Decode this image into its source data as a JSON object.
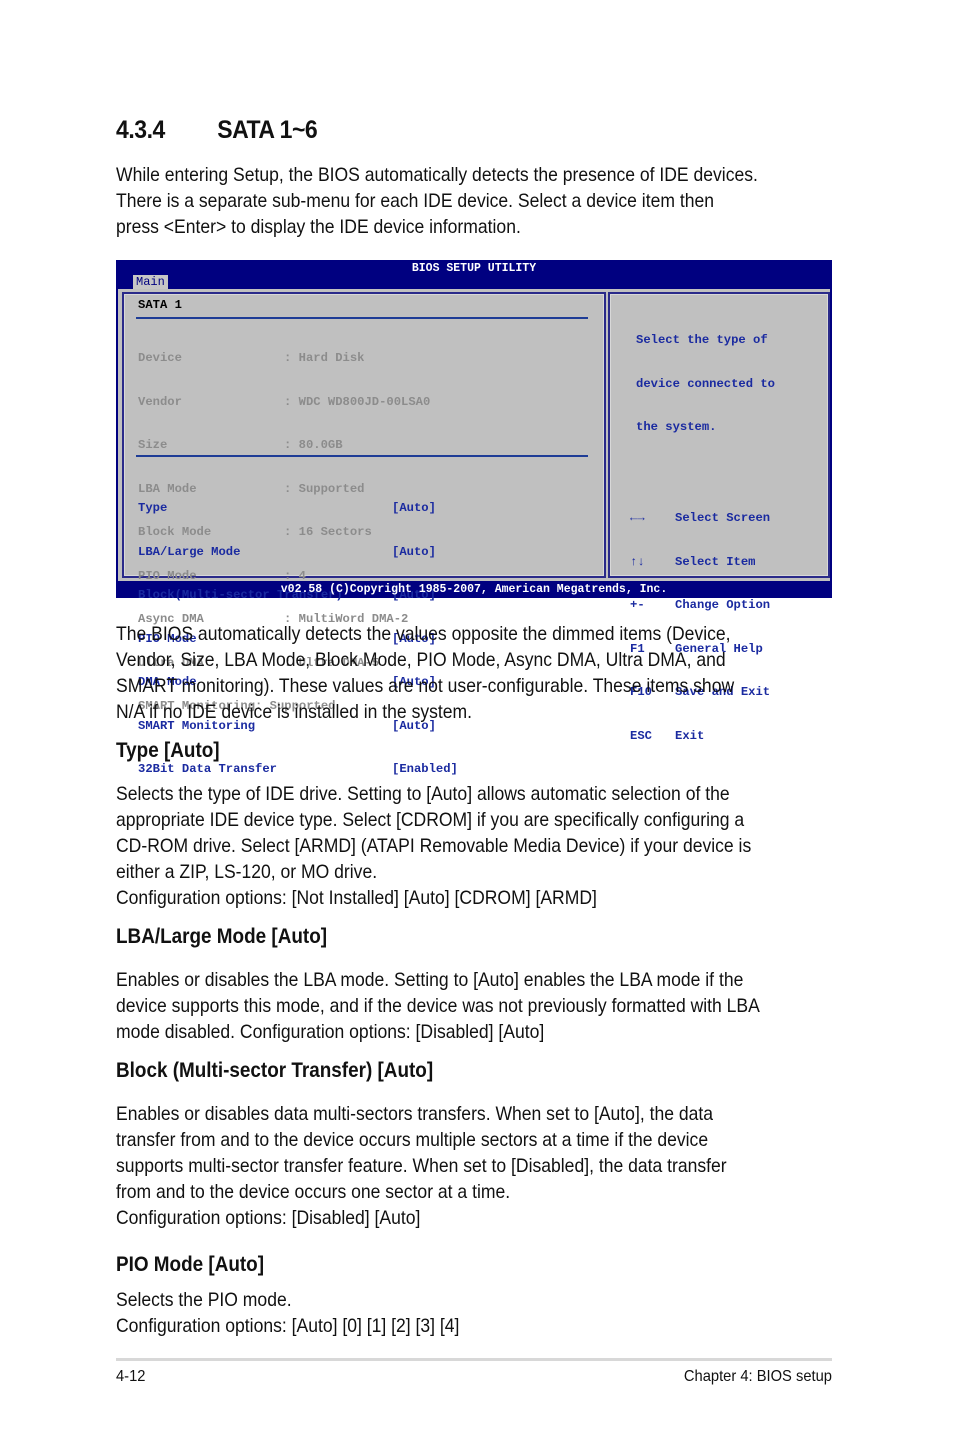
{
  "section": {
    "number": "4.3.4",
    "title": "SATA 1~6",
    "intro": [
      "While entering Setup, the BIOS automatically detects the presence of IDE devices.",
      "There is a separate sub-menu for each IDE device. Select a device item then",
      "press <Enter> to display the IDE device information."
    ]
  },
  "bios": {
    "title": "BIOS SETUP UTILITY",
    "tab": "Main",
    "panel_title": "SATA 1",
    "info": [
      {
        "label": "Device",
        "value": ": Hard Disk"
      },
      {
        "label": "Vendor",
        "value": ": WDC WD800JD-00LSA0"
      },
      {
        "label": "Size",
        "value": ": 80.0GB"
      },
      {
        "label": "LBA Mode",
        "value": ": Supported"
      },
      {
        "label": "Block Mode",
        "value": ": 16 Sectors"
      },
      {
        "label": "PIO Mode",
        "value": ": 4"
      },
      {
        "label": "Async DMA",
        "value": ": MultiWord DMA-2"
      },
      {
        "label": "Ultra DMA",
        "value": ": Ultra DMA-5"
      },
      {
        "label": "SMART Monitoring",
        "value": ": Supported"
      }
    ],
    "options": [
      {
        "label": "Type",
        "value": "[Auto]"
      },
      {
        "label": "LBA/Large Mode",
        "value": "[Auto]"
      },
      {
        "label": "Block(Multi-sector Transfer)",
        "value": "[Auto]"
      },
      {
        "label": "PIO Mode",
        "value": "[Auto]"
      },
      {
        "label": "DMA Mode",
        "value": "[Auto]"
      },
      {
        "label": "SMART Monitoring",
        "value": "[Auto]"
      },
      {
        "label": "32Bit Data Transfer",
        "value": "[Enabled]"
      }
    ],
    "help": [
      "Select the type of",
      "device connected to",
      "the system."
    ],
    "keys": [
      {
        "key": "←→",
        "icon": "left-right-arrows-icon",
        "action": "Select Screen"
      },
      {
        "key": "↑↓",
        "icon": "up-down-arrows-icon",
        "action": "Select Item"
      },
      {
        "key": "+-",
        "action": "Change Option"
      },
      {
        "key": "F1",
        "action": "General Help"
      },
      {
        "key": "F10",
        "action": "Save and Exit"
      },
      {
        "key": "ESC",
        "action": "Exit"
      }
    ],
    "footer": "v02.58 (C)Copyright 1985-2007, American Megatrends, Inc.",
    "colors": {
      "frame": "#000080",
      "panel": "#c0c0c0",
      "option_text": "#1a2aa0",
      "dim_text": "#8c8c8c"
    }
  },
  "after_bios": [
    "The BIOS automatically detects the values opposite the dimmed items (Device,",
    "Vendor, Size, LBA Mode, Block Mode, PIO Mode, Async DMA, Ultra DMA, and",
    "SMART monitoring). These values are not user-configurable. These items show",
    "N/A if no IDE device is installed in the system."
  ],
  "items": [
    {
      "heading": "Type [Auto]",
      "lines": [
        "Selects the type of IDE drive. Setting to [Auto] allows automatic selection of the",
        "appropriate IDE device type. Select [CDROM] if you are specifically configuring a",
        "CD-ROM drive. Select [ARMD] (ATAPI Removable Media Device) if your device is",
        "either a ZIP, LS-120, or MO drive.",
        "Configuration options: [Not Installed] [Auto] [CDROM] [ARMD]"
      ]
    },
    {
      "heading": "LBA/Large Mode [Auto]",
      "lines": [
        "Enables or disables the LBA mode. Setting to [Auto] enables the LBA mode if the",
        "device supports this mode, and if the device was not previously formatted with LBA",
        "mode disabled. Configuration options: [Disabled] [Auto]"
      ]
    },
    {
      "heading": "Block (Multi-sector Transfer) [Auto]",
      "lines": [
        "Enables or disables data multi-sectors transfers. When set to [Auto], the data",
        "transfer from and to the device occurs multiple sectors at a time if the device",
        "supports multi-sector transfer feature. When set to [Disabled], the data transfer",
        "from and to the device occurs one sector at a time.",
        "Configuration options: [Disabled] [Auto]"
      ]
    },
    {
      "heading": "PIO Mode [Auto]",
      "lines": [
        "Selects the PIO mode.",
        "Configuration options: [Auto] [0] [1] [2] [3] [4]"
      ]
    }
  ],
  "footer": {
    "page": "4-12",
    "chapter": "Chapter 4: BIOS setup"
  }
}
